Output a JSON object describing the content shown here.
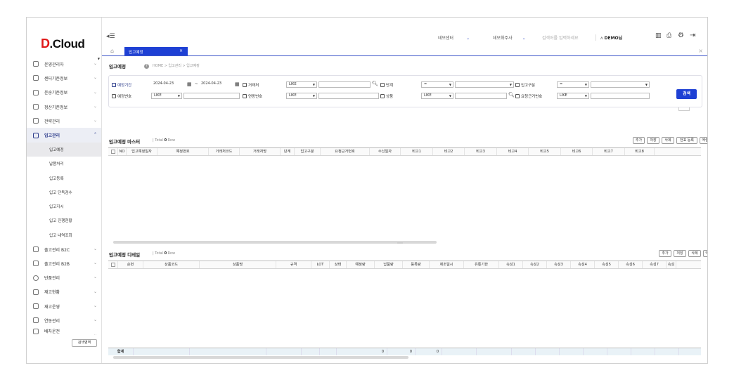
{
  "app": {
    "logo_d": "D",
    "logo_text": ".Cloud"
  },
  "header": {
    "center": "데모센터",
    "shipper": "데모화주사",
    "search_placeholder": "검색어를 입력하세요",
    "user": "DEMO님"
  },
  "tabs": {
    "active": "입고예정",
    "close": "×"
  },
  "sidebar": {
    "items": [
      {
        "label": "운영관리자"
      },
      {
        "label": "센터기준정보"
      },
      {
        "label": "운송기준정보"
      },
      {
        "label": "정산기준정보"
      },
      {
        "label": "전략관리"
      },
      {
        "label": "입고관리"
      }
    ],
    "subitems": [
      "입고예정",
      "납품처리",
      "입고등록",
      "입고 단독검수",
      "입고지시",
      "입고 진행현황",
      "입고 내역조회"
    ],
    "items2": [
      {
        "label": "출고관리 B2C"
      },
      {
        "label": "출고관리 B2B"
      },
      {
        "label": "반품관리"
      },
      {
        "label": "재고현황"
      },
      {
        "label": "재고운영"
      },
      {
        "label": "연동관리"
      },
      {
        "label": "배차운전"
      }
    ],
    "search_area_button": "검색영역"
  },
  "page": {
    "title": "입고예정",
    "breadcrumb": "HOME > 입고관리 > 입고예정"
  },
  "filter": {
    "period_label": "예정기간",
    "date_from": "2024-04-23",
    "date_to": "2024-04-23",
    "date_sep": "~",
    "partner_label": "거래처",
    "partner_op": "LIKE",
    "stage_label": "단계",
    "stage_op": "=",
    "inbound_type_label": "입고구분",
    "inbound_type_op": "=",
    "plan_no_label": "예정번호",
    "plan_no_op": "LIKE",
    "link_no_label": "연동번호",
    "link_no_op": "LIKE",
    "product_label": "상품",
    "product_op": "LIKE",
    "req_no_label": "요청근거번호",
    "req_no_op": "LIKE",
    "search_button": "검색"
  },
  "master": {
    "title": "입고예정 마스터",
    "total_prefix": "Total",
    "total_count": "0",
    "total_suffix": "Row",
    "buttons": [
      "추가",
      "저장",
      "삭제",
      "전표 등록",
      "엑셀"
    ],
    "columns": [
      "NO",
      "입고예정일자",
      "예정번호",
      "거래처코드",
      "거래처명",
      "단계",
      "입고구분",
      "요청근거번호",
      "수신일자",
      "비고1",
      "비고2",
      "비고3",
      "비고4",
      "비고5",
      "비고6",
      "비고7",
      "비고8"
    ]
  },
  "detail": {
    "title": "입고예정 디테일",
    "total_prefix": "Total",
    "total_count": "0",
    "total_suffix": "Row",
    "buttons": [
      "추가",
      "저장",
      "삭제",
      "엑셀"
    ],
    "columns": [
      "순번",
      "상품코드",
      "상품명",
      "규격",
      "LOT",
      "상태",
      "예정량",
      "납품량",
      "등록량",
      "제조일시",
      "유통기한",
      "속성1",
      "속성2",
      "속성3",
      "속성4",
      "속성5",
      "속성6",
      "속성7",
      "속성"
    ],
    "sum_label": "합계",
    "sum_values": [
      "0",
      "0",
      "0"
    ]
  }
}
